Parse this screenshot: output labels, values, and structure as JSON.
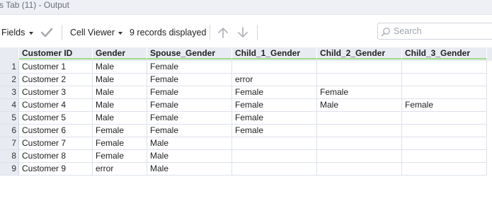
{
  "window": {
    "title": "s Tab (11) - Output"
  },
  "toolbar": {
    "fields_label": "Fields",
    "cell_viewer_label": "Cell Viewer",
    "records_status": "9 records displayed",
    "search_placeholder": "Search"
  },
  "table": {
    "columns": [
      "Customer ID",
      "Gender",
      "Spouse_Gender",
      "Child_1_Gender",
      "Child_2_Gender",
      "Child_3_Gender"
    ],
    "rows": [
      {
        "n": "1",
        "cells": [
          "Customer 1",
          "Male",
          "Female",
          "",
          "",
          ""
        ]
      },
      {
        "n": "2",
        "cells": [
          "Customer 2",
          "Male",
          "Female",
          "error",
          "",
          ""
        ]
      },
      {
        "n": "3",
        "cells": [
          "Customer 3",
          "Male",
          "Female",
          "Female",
          "Female",
          ""
        ]
      },
      {
        "n": "4",
        "cells": [
          "Customer 4",
          "Male",
          "Female",
          "Female",
          "Male",
          "Female"
        ]
      },
      {
        "n": "5",
        "cells": [
          "Customer 5",
          "Male",
          "Female",
          "Female",
          "",
          ""
        ]
      },
      {
        "n": "6",
        "cells": [
          "Customer 6",
          "Female",
          "Female",
          "Female",
          "",
          ""
        ]
      },
      {
        "n": "7",
        "cells": [
          "Customer 7",
          "Female",
          "Male",
          "",
          "",
          ""
        ]
      },
      {
        "n": "8",
        "cells": [
          "Customer 8",
          "Female",
          "Male",
          "",
          "",
          ""
        ]
      },
      {
        "n": "9",
        "cells": [
          "Customer 9",
          "error",
          "Male",
          "",
          "",
          ""
        ]
      }
    ]
  },
  "colors": {
    "header_bg": "#e9ebf2",
    "header_underline": "#9fdd8a",
    "grid_line": "#dde1ea",
    "titlebar_bg": "#eef0f6"
  }
}
